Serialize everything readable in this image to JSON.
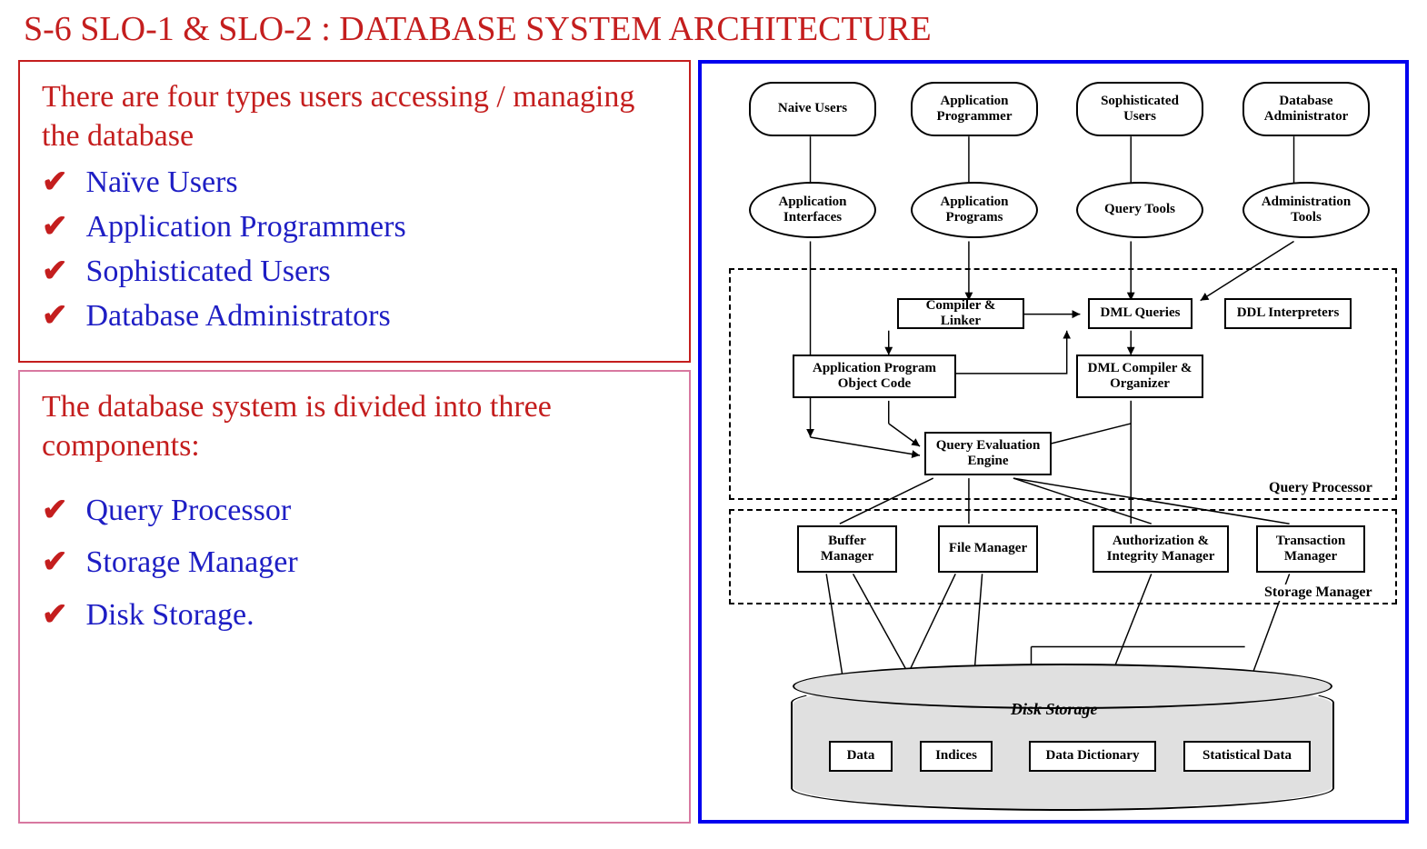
{
  "title": "S-6  SLO-1 & SLO-2 : DATABASE SYSTEM ARCHITECTURE",
  "box1": {
    "intro": "There are four types users accessing / managing the database",
    "items": [
      "Naïve Users",
      "Application Programmers",
      "Sophisticated Users",
      "Database Administrators"
    ]
  },
  "box2": {
    "intro": "The database system is divided into three components:",
    "items": [
      "Query Processor",
      "Storage Manager",
      "Disk Storage."
    ]
  },
  "diagram": {
    "users": [
      "Naive Users",
      "Application Programmer",
      "Sophisticated Users",
      "Database Administrator"
    ],
    "tools": [
      "Application Interfaces",
      "Application Programs",
      "Query Tools",
      "Administration Tools"
    ],
    "qp": {
      "compiler_linker": "Compiler & Linker",
      "dml_queries": "DML Queries",
      "ddl_interpreters": "DDL Interpreters",
      "app_obj_code": "Application Program Object Code",
      "dml_compiler": "DML Compiler & Organizer",
      "query_eval": "Query Evaluation Engine",
      "label": "Query Processor"
    },
    "sm": {
      "buffer": "Buffer Manager",
      "file": "File Manager",
      "auth": "Authorization & Integrity Manager",
      "txn": "Transaction Manager",
      "label": "Storage Manager"
    },
    "disk": {
      "label": "Disk Storage",
      "data": "Data",
      "indices": "Indices",
      "dict": "Data Dictionary",
      "stats": "Statistical Data"
    }
  }
}
